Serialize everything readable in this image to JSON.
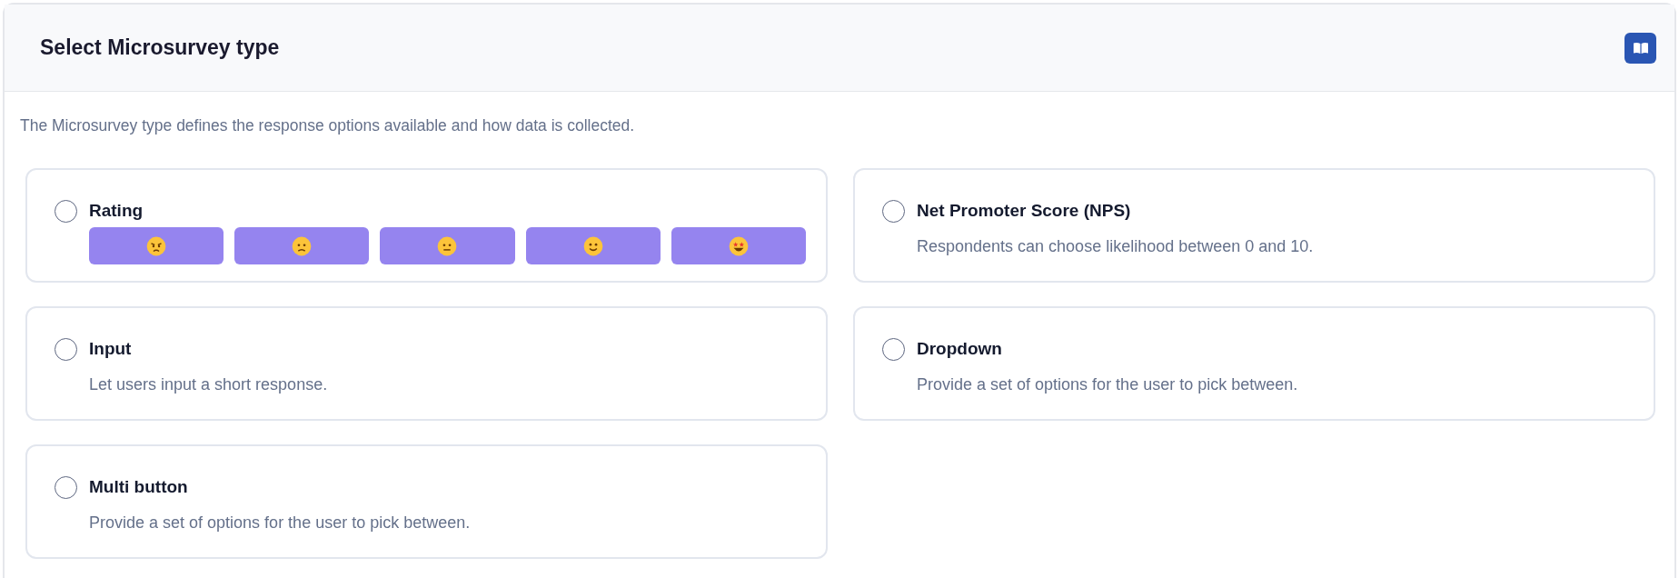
{
  "panel": {
    "title": "Select Microsurvey type",
    "description": "The Microsurvey type defines the response options available and how data is collected."
  },
  "options": [
    {
      "kind": "rating",
      "title": "Rating",
      "selected": false
    },
    {
      "kind": "text",
      "title": "Net Promoter Score (NPS)",
      "description": "Respondents can choose likelihood between 0 and 10.",
      "selected": false
    },
    {
      "kind": "text",
      "title": "Input",
      "description": "Let users input a short response.",
      "selected": false
    },
    {
      "kind": "text",
      "title": "Dropdown",
      "description": "Provide a set of options for the user to pick between.",
      "selected": false
    },
    {
      "kind": "text",
      "title": "Multi button",
      "description": "Provide a set of options for the user to pick between.",
      "selected": false
    }
  ]
}
